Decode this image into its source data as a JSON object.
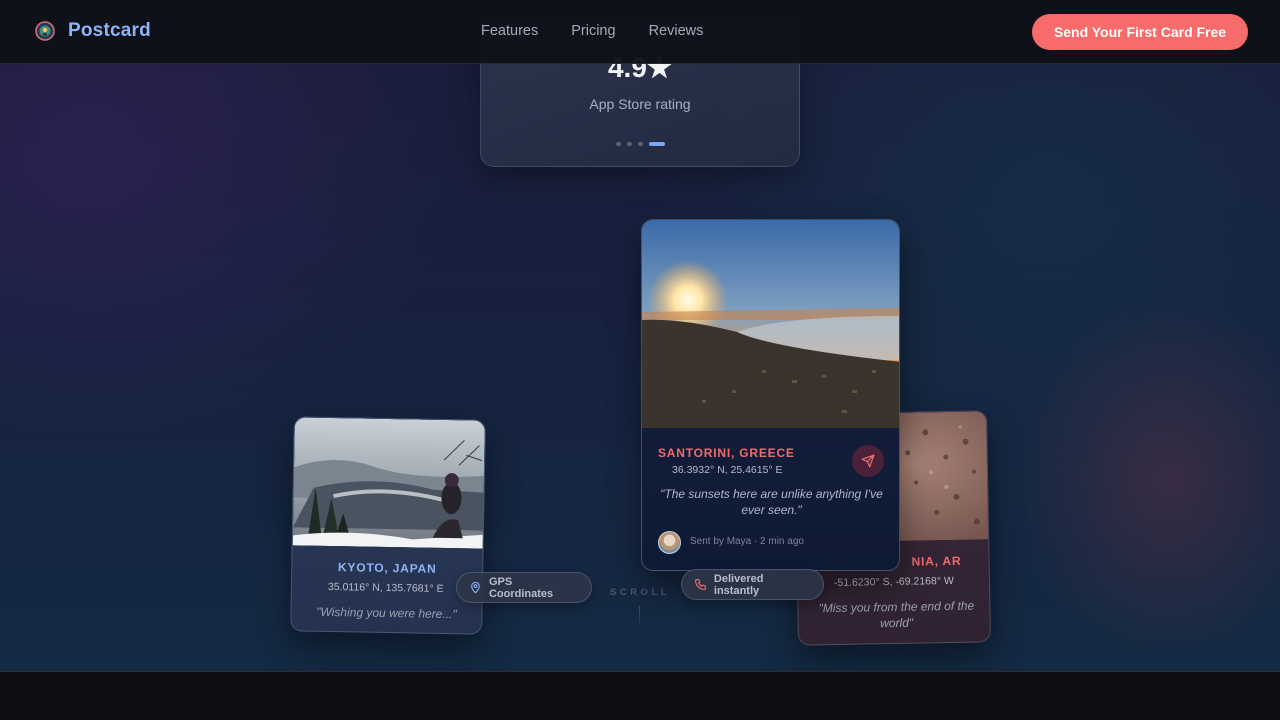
{
  "nav": {
    "brand": "Postcard",
    "links": [
      "Features",
      "Pricing",
      "Reviews"
    ],
    "cta": "Send Your First Card Free"
  },
  "rating": {
    "value": "4.9★",
    "label": "App Store rating",
    "carousel_slides": 4,
    "active_slide": 4
  },
  "cards": {
    "kyoto": {
      "city": "KYOTO, JAPAN",
      "coords": "35.0116° N, 135.7681° E",
      "quote": "\"Wishing you were here...\""
    },
    "santorini": {
      "city": "SANTORINI, GREECE",
      "coords": "36.3932° N, 25.4615° E",
      "quote": "\"The sunsets here are unlike anything I've ever seen.\"",
      "sent_by": "Sent by Maya · 2 min ago"
    },
    "argentina": {
      "city": "NIA, AR",
      "coords": "-51.6230° S, -69.2168° W",
      "quote": "\"Miss you from the end of the world\""
    }
  },
  "pills": {
    "gps": "GPS Coordinates",
    "delivered": "Delivered instantly"
  },
  "scroll_label": "SCROLL",
  "colors": {
    "accent_blue": "#8fb4f6",
    "accent_coral": "#f76b6b",
    "city_red": "#f26b6b",
    "city_blue": "#8fb4f6"
  },
  "icons": [
    "globe-icon",
    "send-icon",
    "map-pin-icon",
    "phone-icon"
  ]
}
